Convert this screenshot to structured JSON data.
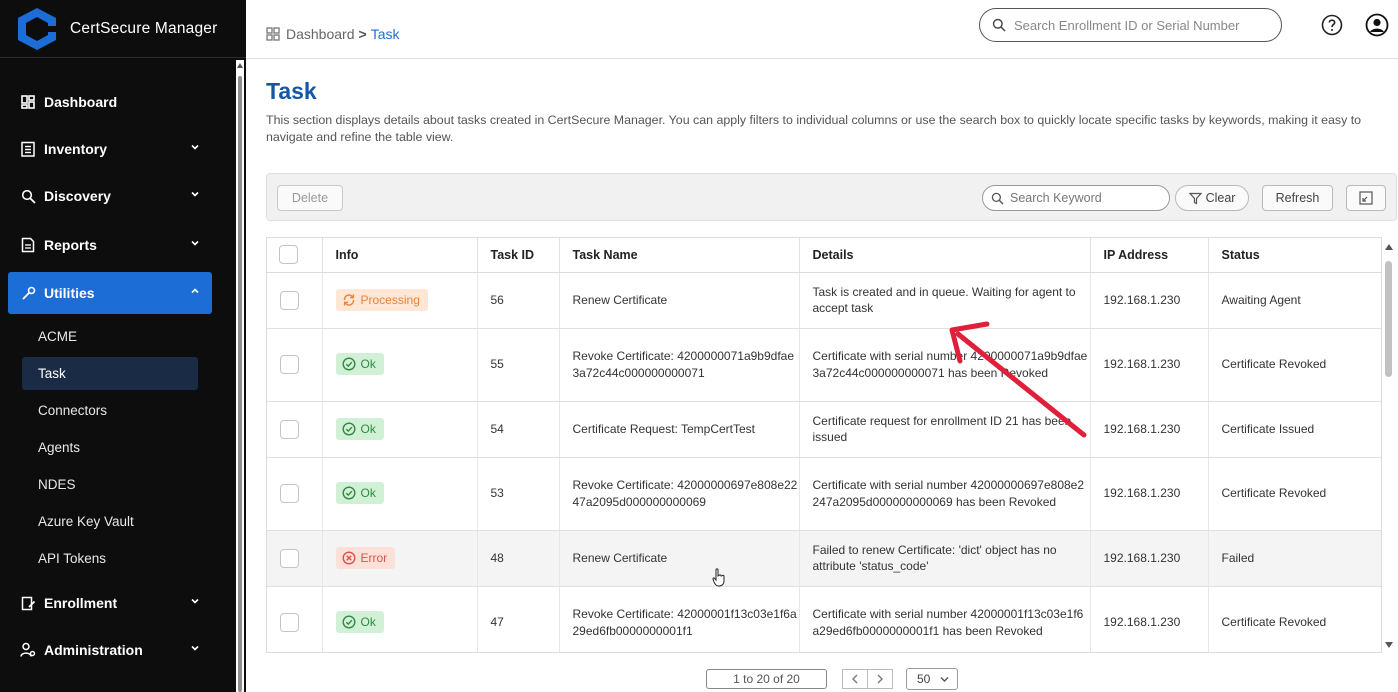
{
  "app": {
    "title": "CertSecure Manager",
    "brand_color": "#1c6ed6"
  },
  "sidebar": {
    "items": [
      {
        "label": "Dashboard",
        "icon": "dashboard-icon",
        "expandable": false
      },
      {
        "label": "Inventory",
        "icon": "inventory-icon",
        "expandable": true
      },
      {
        "label": "Discovery",
        "icon": "discovery-icon",
        "expandable": true
      },
      {
        "label": "Reports",
        "icon": "reports-icon",
        "expandable": true
      },
      {
        "label": "Utilities",
        "icon": "utilities-icon",
        "expandable": true,
        "active": true
      }
    ],
    "sub_items": [
      "ACME",
      "Task",
      "Connectors",
      "Agents",
      "NDES",
      "Azure Key Vault",
      "API Tokens"
    ],
    "active_sub": "Task",
    "bottom_items": [
      {
        "label": "Enrollment",
        "icon": "enrollment-icon"
      },
      {
        "label": "Administration",
        "icon": "administration-icon"
      }
    ]
  },
  "topbar": {
    "breadcrumb": {
      "root": "Dashboard",
      "separator": ">",
      "current": "Task"
    },
    "search_placeholder": "Search Enrollment ID or Serial Number"
  },
  "page": {
    "title": "Task",
    "description": "This section displays details about tasks created in CertSecure Manager. You can apply filters to individual columns or use the search box to quickly locate specific tasks by keywords, making it easy to navigate and refine the table view."
  },
  "toolbar": {
    "delete_label": "Delete",
    "search_placeholder": "Search Keyword",
    "clear_label": "Clear",
    "refresh_label": "Refresh"
  },
  "table": {
    "columns": [
      "Info",
      "Task ID",
      "Task Name",
      "Details",
      "IP Address",
      "Status"
    ],
    "rows": [
      {
        "info": "Processing",
        "info_type": "processing",
        "task_id": "56",
        "task_name": "Renew Certificate",
        "details": "Task is created and in queue. Waiting for agent to accept task",
        "ip": "192.168.1.230",
        "status": "Awaiting Agent"
      },
      {
        "info": "Ok",
        "info_type": "ok",
        "task_id": "55",
        "task_name": "Revoke Certificate: 4200000071a9b9dfae3a72c44c000000000071",
        "details": "Certificate with serial number 4200000071a9b9dfae3a72c44c000000000071 has been Revoked",
        "ip": "192.168.1.230",
        "status": "Certificate Revoked"
      },
      {
        "info": "Ok",
        "info_type": "ok",
        "task_id": "54",
        "task_name": "Certificate Request: TempCertTest",
        "details": "Certificate request for enrollment ID 21 has been issued",
        "ip": "192.168.1.230",
        "status": "Certificate Issued"
      },
      {
        "info": "Ok",
        "info_type": "ok",
        "task_id": "53",
        "task_name": "Revoke Certificate: 42000000697e808e2247a2095d000000000069",
        "details": "Certificate with serial number 42000000697e808e2247a2095d000000000069 has been Revoked",
        "ip": "192.168.1.230",
        "status": "Certificate Revoked"
      },
      {
        "info": "Error",
        "info_type": "error",
        "task_id": "48",
        "task_name": "Renew Certificate",
        "details": "Failed to renew Certificate: 'dict' object has no attribute 'status_code'",
        "ip": "192.168.1.230",
        "status": "Failed"
      },
      {
        "info": "Ok",
        "info_type": "ok",
        "task_id": "47",
        "task_name": "Revoke Certificate: 42000001f13c03e1f6a29ed6fb0000000001f1",
        "details": "Certificate with serial number 42000001f13c03e1f6a29ed6fb0000000001f1 has been Revoked",
        "ip": "192.168.1.230",
        "status": "Certificate Revoked"
      }
    ]
  },
  "pagination": {
    "info": "1 to 20 of 20",
    "page_size": "50"
  },
  "annotation": {
    "arrow_color": "#e0203a"
  }
}
